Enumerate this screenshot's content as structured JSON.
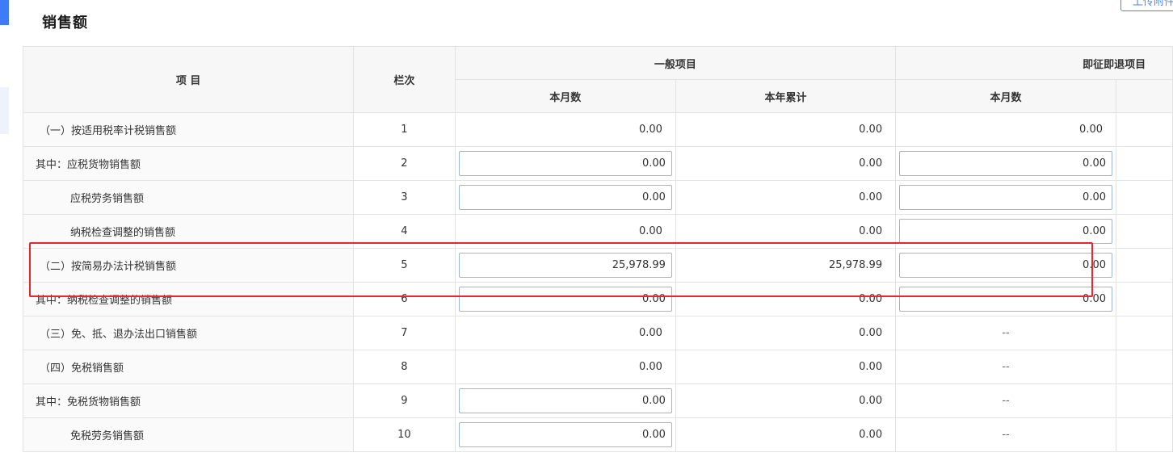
{
  "section_title": "销售额",
  "upload_button_label": "上传附件",
  "table": {
    "headers": {
      "item": "项 目",
      "line": "栏次",
      "general_group": "一般项目",
      "immediate_group": "即征即退项目",
      "general_month": "本月数",
      "general_year": "本年累计",
      "immediate_month": "本月数"
    },
    "rows": [
      {
        "name": "（一）按适用税率计税销售额",
        "line": "1",
        "g_month": "0.00",
        "g_year": "0.00",
        "i_month": "0.00"
      },
      {
        "name": "其中：应税货物销售额",
        "line": "2",
        "g_month": "0.00",
        "g_year": "0.00",
        "i_month": "0.00"
      },
      {
        "name": "应税劳务销售额",
        "line": "3",
        "g_month": "0.00",
        "g_year": "0.00",
        "i_month": "0.00"
      },
      {
        "name": "纳税检查调整的销售额",
        "line": "4",
        "g_month": "0.00",
        "g_year": "0.00",
        "i_month": "0.00"
      },
      {
        "name": "（二）按简易办法计税销售额",
        "line": "5",
        "g_month": "25,978.99",
        "g_year": "25,978.99",
        "i_month": "0.00"
      },
      {
        "name": "其中：纳税检查调整的销售额",
        "line": "6",
        "g_month": "0.00",
        "g_year": "0.00",
        "i_month": "0.00"
      },
      {
        "name": "（三）免、抵、退办法出口销售额",
        "line": "7",
        "g_month": "0.00",
        "g_year": "0.00",
        "i_month": "--"
      },
      {
        "name": "（四）免税销售额",
        "line": "8",
        "g_month": "0.00",
        "g_year": "0.00",
        "i_month": "--"
      },
      {
        "name": "其中：免税货物销售额",
        "line": "9",
        "g_month": "0.00",
        "g_year": "0.00",
        "i_month": "--"
      },
      {
        "name": "免税劳务销售额",
        "line": "10",
        "g_month": "0.00",
        "g_year": "0.00",
        "i_month": "--"
      }
    ]
  },
  "colors": {
    "highlight_border": "#e8272c",
    "accent": "#3d7bf7",
    "input_border": "#9db6d8"
  }
}
